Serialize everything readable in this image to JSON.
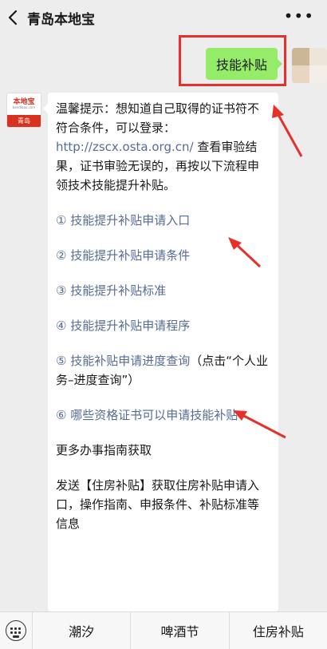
{
  "header": {
    "title": "青岛本地宝"
  },
  "outgoing": {
    "message": "技能补贴"
  },
  "account": {
    "logo_top": "本地宝",
    "logo_sub": "bendibao.com",
    "logo_city": "青岛"
  },
  "reply": {
    "intro_prefix": "温馨提示：想知道自己取得的证书符不符合条件，可以登录：",
    "intro_link": "http://zscx.osta.org.cn/",
    "intro_suffix": " 查看审验结果，证书审验无误的，再按以下流程申领技术技能提升补贴。",
    "items": [
      "① 技能提升补贴申请入口",
      "② 技能提升补贴申请条件",
      "③ 技能提升补贴标准",
      "④ 技能提升补贴申请程序"
    ],
    "item5_link": "⑤ 技能补贴申请进度查询",
    "item5_note": "（点击“个人业务–进度查询”）",
    "item6": "⑥ 哪些资格证书可以申请技能补贴",
    "more": "更多办事指南获取",
    "footer": "发送【住房补贴】获取住房补贴申请入口，操作指南、申报条件、补贴标准等信息"
  },
  "bottom_menu": [
    "潮汐",
    "啤酒节",
    "住房补贴"
  ],
  "colors": {
    "link": "#576b95",
    "bubble_out": "#95ec69",
    "annotation": "#e6302c"
  }
}
